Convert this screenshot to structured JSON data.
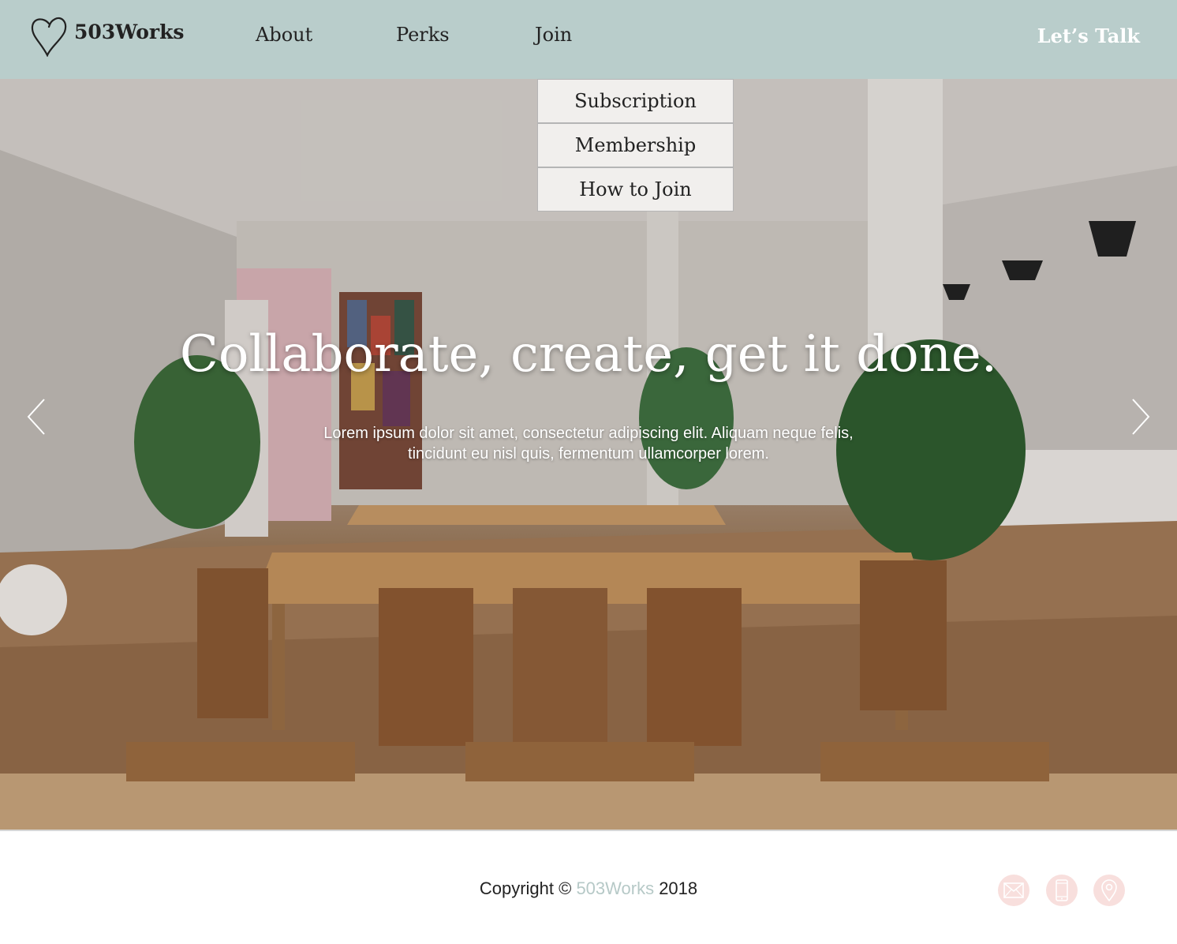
{
  "brand": {
    "name": "503Works",
    "icon": "heart-logo-icon"
  },
  "nav": {
    "items": [
      {
        "label": "About"
      },
      {
        "label": "Perks"
      },
      {
        "label": "Join"
      }
    ],
    "cta_label": "Let’s Talk"
  },
  "dropdown": {
    "items": [
      {
        "label": "Subscription"
      },
      {
        "label": "Membership"
      },
      {
        "label": "How to Join"
      }
    ]
  },
  "hero": {
    "title": "Collaborate, create, get it done.",
    "text_line1": "Lorem ipsum dolor sit amet, consectetur adipiscing elit. Aliquam neque felis,",
    "text_line2": "tincidunt eu nisl quis, fermentum ullamcorper lorem.",
    "prev_icon": "chevron-left-icon",
    "next_icon": "chevron-right-icon"
  },
  "footer": {
    "copyright_prefix": "Copyright © ",
    "copyright_brand": "503Works",
    "copyright_suffix": " 2018",
    "icons": [
      "mail-icon",
      "phone-icon",
      "location-pin-icon"
    ]
  },
  "colors": {
    "header_bg": "#b9cdcb",
    "brand_accent": "#b6c9c7",
    "icon_circle_bg": "#f8dfdd",
    "dropdown_bg": "#f1efed"
  }
}
